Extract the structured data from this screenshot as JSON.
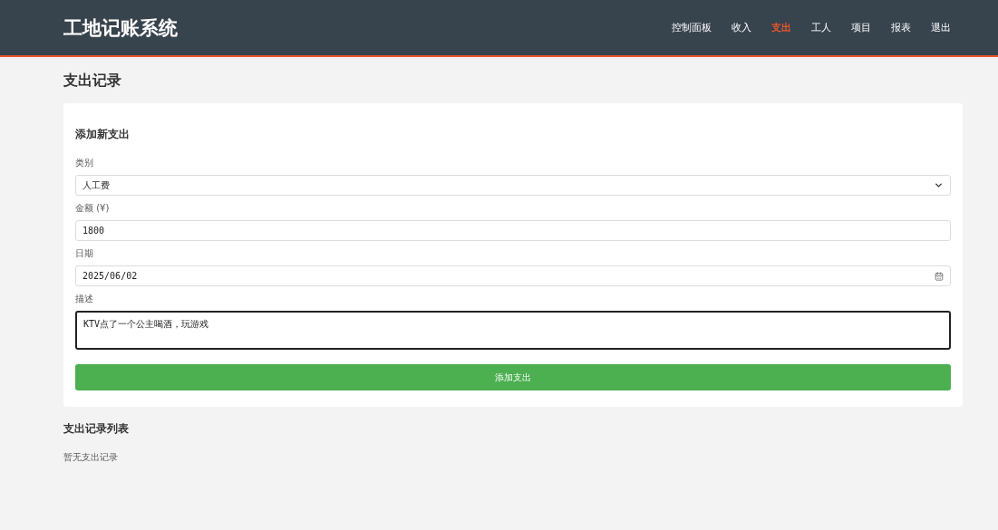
{
  "header": {
    "logo": "工地记账系统",
    "nav": [
      {
        "label": "控制面板",
        "selected": false
      },
      {
        "label": "收入",
        "selected": false
      },
      {
        "label": "支出",
        "selected": true
      },
      {
        "label": "工人",
        "selected": false
      },
      {
        "label": "项目",
        "selected": false
      },
      {
        "label": "报表",
        "selected": false
      },
      {
        "label": "退出",
        "selected": false
      }
    ]
  },
  "page_title": "支出记录",
  "form": {
    "title": "添加新支出",
    "fields": [
      {
        "kind": "select",
        "label": "类别",
        "value": "人工费",
        "focused": false
      },
      {
        "kind": "input",
        "label": "金额 (¥)",
        "value": "1800",
        "focused": false
      },
      {
        "kind": "date",
        "label": "日期",
        "value": "2025/06/02",
        "focused": false
      },
      {
        "kind": "textarea",
        "label": "描述",
        "value": "KTV点了一个公主喝酒，玩游戏",
        "focused": true
      }
    ],
    "submit": "添加支出"
  },
  "list": {
    "title": "支出记录列表",
    "empty_text": "暂无支出记录"
  }
}
